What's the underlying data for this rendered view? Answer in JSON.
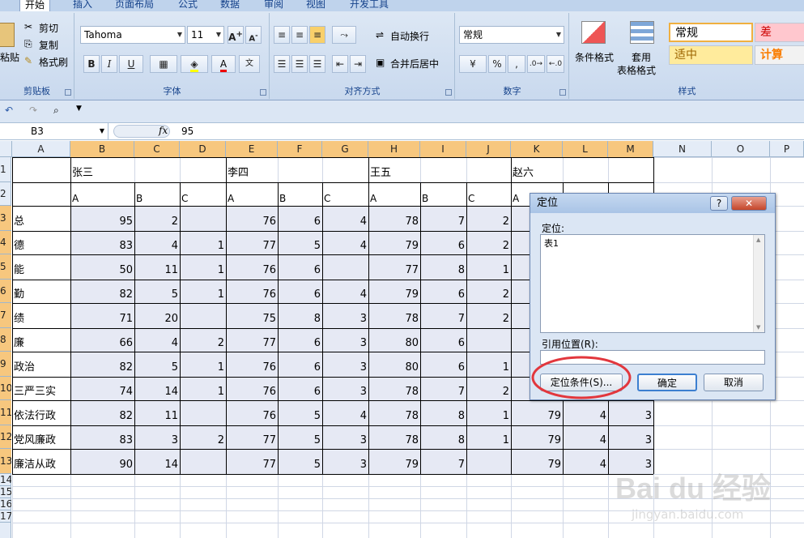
{
  "ribbon": {
    "tabs": [
      "开始",
      "插入",
      "页面布局",
      "公式",
      "数据",
      "审阅",
      "视图",
      "开发工具"
    ],
    "clipboard": {
      "paste": "粘贴",
      "cut": "剪切",
      "copy": "复制",
      "format_painter": "格式刷",
      "label": "剪贴板"
    },
    "font": {
      "name": "Tahoma",
      "size": "11",
      "bold": "B",
      "italic": "I",
      "underline": "U",
      "label": "字体"
    },
    "alignment": {
      "wrap": "自动换行",
      "merge": "合并后居中",
      "label": "对齐方式"
    },
    "number": {
      "format": "常规",
      "percent": "%",
      "comma": ",",
      "label": "数字"
    },
    "styles": {
      "conditional": "条件格式",
      "table": "套用",
      "table2": "表格格式",
      "normal": "常规",
      "bad": "差",
      "neutral": "适中",
      "calc": "计算",
      "label": "样式"
    }
  },
  "formula_bar": {
    "name_box": "B3",
    "fx": "fx",
    "value": "95"
  },
  "columns": [
    "A",
    "B",
    "C",
    "D",
    "E",
    "F",
    "G",
    "H",
    "I",
    "J",
    "K",
    "L",
    "M",
    "N",
    "O",
    "P"
  ],
  "rows": [
    "1",
    "2",
    "3",
    "4",
    "5",
    "6",
    "7",
    "8",
    "9",
    "10",
    "11",
    "12",
    "13",
    "14",
    "15",
    "16",
    "17"
  ],
  "sheet": {
    "names": [
      "张三",
      "李四",
      "王五",
      "赵六"
    ],
    "sub": [
      "A",
      "B",
      "C",
      "A",
      "B",
      "C",
      "A",
      "B",
      "C",
      "A"
    ],
    "data_rows": [
      {
        "label": "总",
        "vals": [
          "95",
          "2",
          "",
          "76",
          "6",
          "4",
          "78",
          "7",
          "2",
          "",
          "",
          ""
        ]
      },
      {
        "label": "德",
        "vals": [
          "83",
          "4",
          "1",
          "77",
          "5",
          "4",
          "79",
          "6",
          "2",
          "",
          "",
          ""
        ]
      },
      {
        "label": "能",
        "vals": [
          "50",
          "11",
          "1",
          "76",
          "6",
          "",
          "77",
          "8",
          "1",
          "",
          "",
          ""
        ]
      },
      {
        "label": "勤",
        "vals": [
          "82",
          "5",
          "1",
          "76",
          "6",
          "4",
          "79",
          "6",
          "2",
          "",
          "",
          ""
        ]
      },
      {
        "label": "绩",
        "vals": [
          "71",
          "20",
          "",
          "75",
          "8",
          "3",
          "78",
          "7",
          "2",
          "",
          "",
          ""
        ]
      },
      {
        "label": "廉",
        "vals": [
          "66",
          "4",
          "2",
          "77",
          "6",
          "3",
          "80",
          "6",
          "",
          "",
          "",
          ""
        ]
      },
      {
        "label": "政治",
        "vals": [
          "82",
          "5",
          "1",
          "76",
          "6",
          "3",
          "80",
          "6",
          "1",
          "",
          "",
          ""
        ]
      },
      {
        "label": "三严三实",
        "vals": [
          "74",
          "14",
          "1",
          "76",
          "6",
          "3",
          "78",
          "7",
          "2",
          "",
          "",
          ""
        ]
      },
      {
        "label": "依法行政",
        "vals": [
          "82",
          "11",
          "",
          "76",
          "5",
          "4",
          "78",
          "8",
          "1",
          "79",
          "4",
          "3"
        ]
      },
      {
        "label": "党风廉政",
        "vals": [
          "83",
          "3",
          "2",
          "77",
          "5",
          "3",
          "78",
          "8",
          "1",
          "79",
          "4",
          "3"
        ]
      },
      {
        "label": "廉洁从政",
        "vals": [
          "90",
          "14",
          "",
          "77",
          "5",
          "3",
          "79",
          "7",
          "",
          "79",
          "4",
          "3"
        ]
      }
    ]
  },
  "dialog": {
    "title": "定位",
    "help": "?",
    "close": "✕",
    "goto_label": "定位:",
    "list_item": "表1",
    "ref_label": "引用位置(R):",
    "ref_value": "",
    "special_btn": "定位条件(S)...",
    "ok_btn": "确定",
    "cancel_btn": "取消"
  },
  "colors": {
    "highlight": "#e2373d",
    "selected_header": "#f7c77e",
    "selection_fill": "#e6e9f4"
  },
  "watermark": {
    "brand": "Bai du 经验",
    "url": "jingyan.baidu.com"
  }
}
